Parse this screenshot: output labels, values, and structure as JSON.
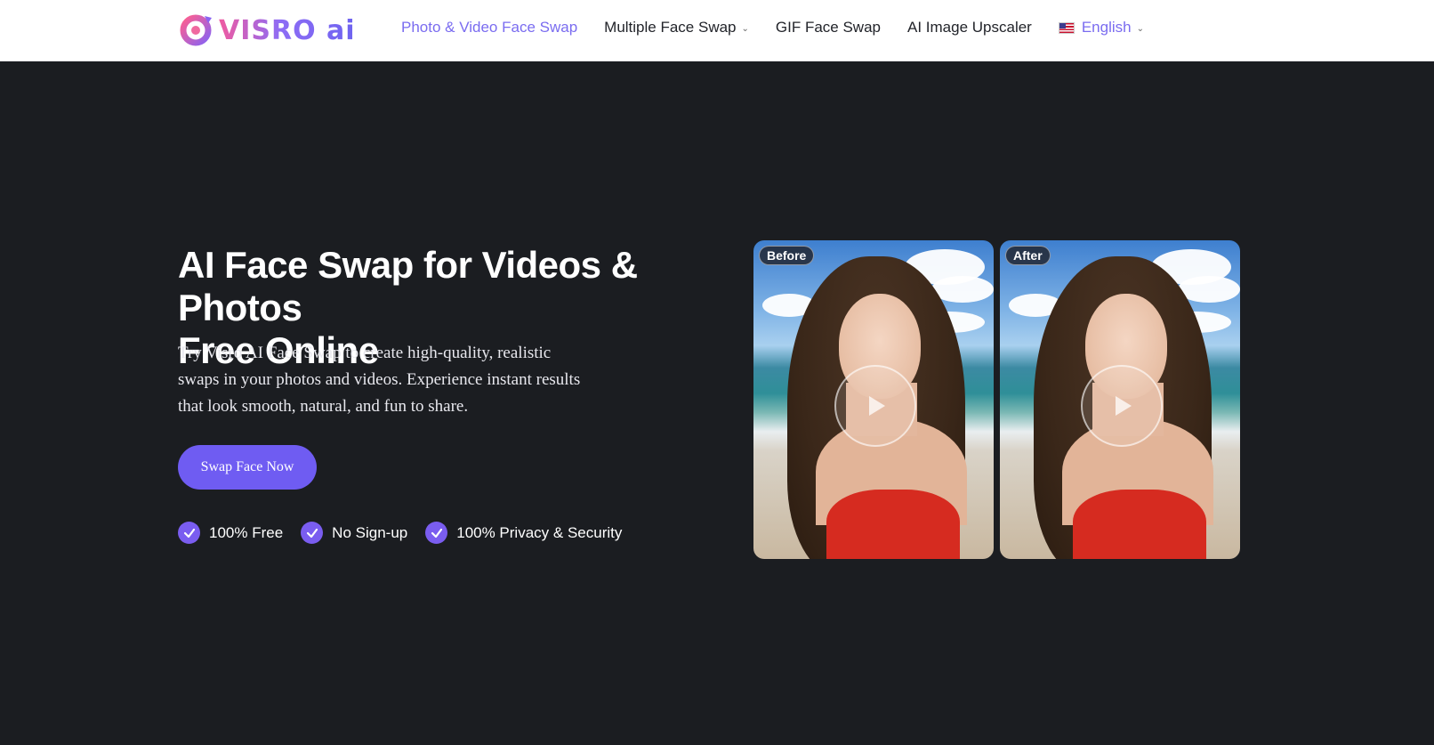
{
  "brand": {
    "logo_text": "VISRO ai"
  },
  "nav": {
    "items": [
      {
        "label": "Photo & Video Face Swap",
        "active": true,
        "dropdown": false
      },
      {
        "label": "Multiple Face Swap",
        "active": false,
        "dropdown": true
      },
      {
        "label": "GIF Face Swap",
        "active": false,
        "dropdown": false
      },
      {
        "label": "AI Image Upscaler",
        "active": false,
        "dropdown": false
      }
    ],
    "language": {
      "label": "English",
      "icon": "us-flag-icon"
    }
  },
  "hero": {
    "title_line1": "AI Face Swap for Videos & Photos",
    "title_line2": "Free Online",
    "description": "Try Visro AI Face Swap to create high-quality, realistic swaps in your photos and videos. Experience instant results that look smooth, natural, and fun to share.",
    "cta_label": "Swap Face Now",
    "features": [
      "100% Free",
      "No Sign-up",
      "100% Privacy & Security"
    ]
  },
  "media": {
    "before_label": "Before",
    "after_label": "After"
  },
  "colors": {
    "accent": "#6f5cf2",
    "background": "#1b1d21",
    "header_bg": "#ffffff",
    "nav_active": "#7a6cf0"
  }
}
